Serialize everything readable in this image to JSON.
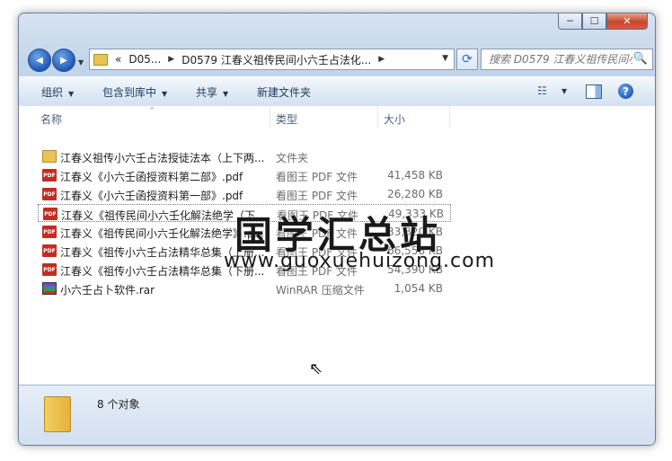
{
  "window": {
    "controls": {
      "minimize": "─",
      "maximize": "☐",
      "close": "✕"
    }
  },
  "nav": {
    "back_icon": "◀",
    "forward_icon": "▶",
    "recent_dropdown": "▼",
    "address": {
      "overflow": "«",
      "segment1": "D05...",
      "sep1": "▶",
      "segment2": "D0579 江春义祖传民间小六壬占法化...",
      "sep2": "▶",
      "dropdown": "▼"
    },
    "refresh_icon": "⟳",
    "search": {
      "placeholder": "搜索 D0579 江春义祖传民间小...",
      "icon": "🔍"
    }
  },
  "toolbar": {
    "organize": "组织",
    "include_in_library": "包含到库中",
    "share": "共享",
    "new_folder": "新建文件夹",
    "dropdown_arrow": "▼",
    "view_icon": "☷",
    "help": "?"
  },
  "columns": {
    "name": "名称",
    "type": "类型",
    "size": "大小",
    "sort_caret": "^"
  },
  "files": [
    {
      "name": "江春义祖传小六壬占法授徒法本（上下两...",
      "type": "文件夹",
      "size": "",
      "icon": "folder-icon"
    },
    {
      "name": "江春义《小六壬函授资料第二部》.pdf",
      "type": "看图王 PDF 文件",
      "size": "41,458 KB",
      "icon": "pdf-icon"
    },
    {
      "name": "江春义《小六壬函授资料第一部》.pdf",
      "type": "看图王 PDF 文件",
      "size": "26,280 KB",
      "icon": "pdf-icon"
    },
    {
      "name": "江春义《祖传民间小六壬化解法绝学（下...",
      "type": "看图王 PDF 文件",
      "size": "49,333 KB",
      "icon": "pdf-icon"
    },
    {
      "name": "江春义《祖传民间小六壬化解法绝学》.p...",
      "type": "看图王 PDF 文件",
      "size": "33,820 KB",
      "icon": "pdf-icon"
    },
    {
      "name": "江春义《祖传小六壬占法精华总集（上册...",
      "type": "看图王 PDF 文件",
      "size": "66,558 KB",
      "icon": "pdf-icon"
    },
    {
      "name": "江春义《祖传小六壬占法精华总集（下册...",
      "type": "看图王 PDF 文件",
      "size": "54,390 KB",
      "icon": "pdf-icon"
    },
    {
      "name": "小六壬占卜软件.rar",
      "type": "WinRAR 压缩文件",
      "size": "1,054 KB",
      "icon": "rar-icon"
    }
  ],
  "pdf_badge": "PDF",
  "watermark": {
    "text": "国学汇总站",
    "url": "www.guoxuehuizong.com"
  },
  "cursor": "⇖",
  "details": {
    "count": "8 个对象"
  }
}
